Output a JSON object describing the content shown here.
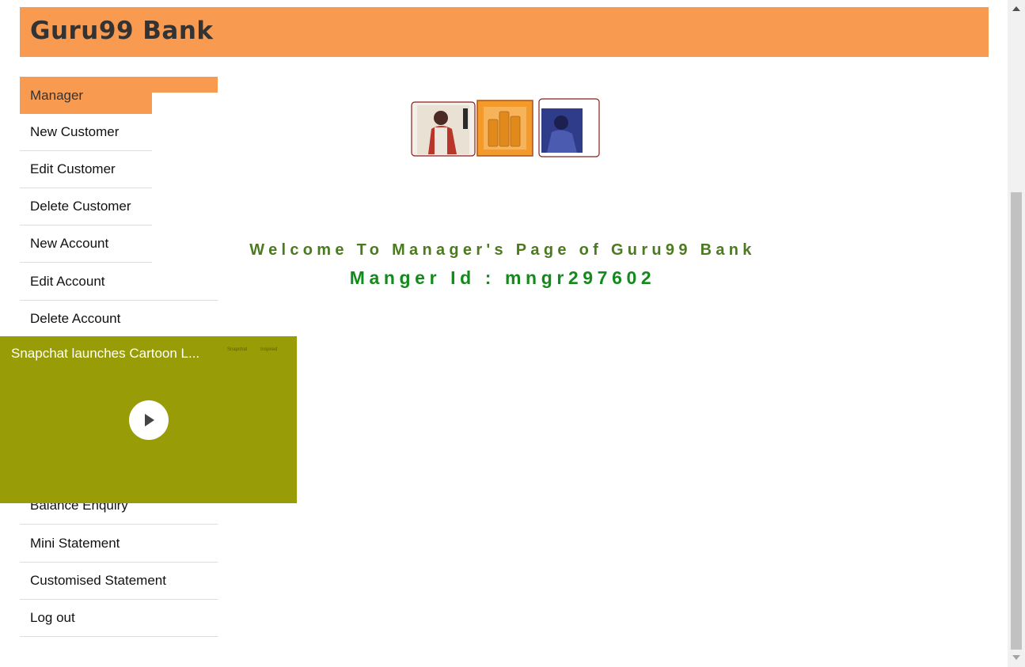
{
  "header": {
    "brand": "Guru99 Bank"
  },
  "menu": {
    "items": [
      "Manager",
      "New Customer",
      "Edit Customer",
      "Delete Customer",
      "New Account",
      "Edit Account",
      "Delete Account",
      "Balance Enquiry",
      "Mini Statement",
      "Customised Statement",
      "Log out"
    ]
  },
  "main": {
    "welcome": "Welcome To Manager's Page of Guru99 Bank",
    "manager_id": "Manger Id : mngr297602"
  },
  "video": {
    "title": "Snapchat launches Cartoon L...",
    "tiny_left": "Snapchat",
    "tiny_right": "Inspired"
  },
  "colors": {
    "header": "#f89b51",
    "welcome": "#4b7a1f",
    "manager_id": "#138a1b",
    "video_bg": "#989c06"
  }
}
